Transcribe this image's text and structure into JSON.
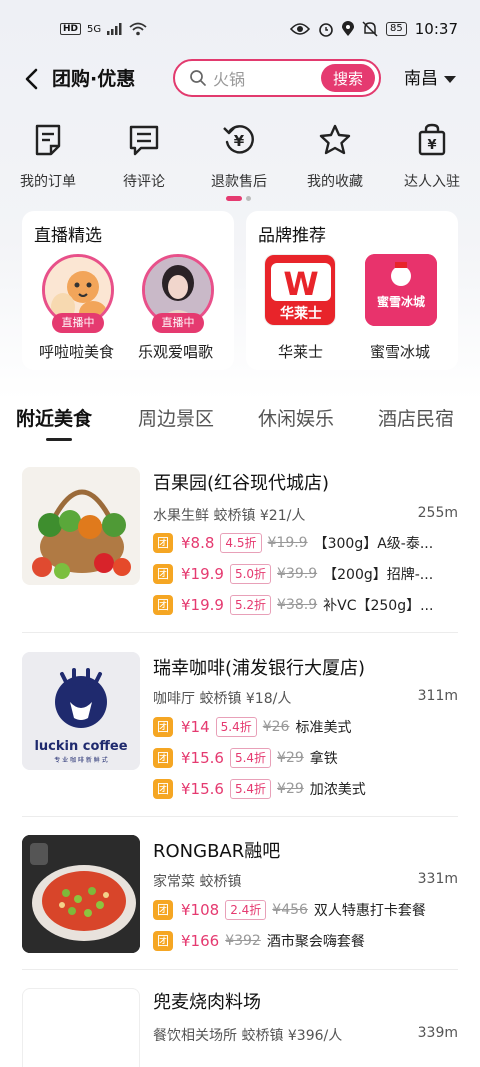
{
  "status": {
    "hd": "HD",
    "network": "5G",
    "battery": "85",
    "time": "10:37"
  },
  "nav": {
    "title": "团购·优惠",
    "search_value": "火锅",
    "search_button": "搜索",
    "city": "南昌"
  },
  "quick_entries": [
    {
      "label": "我的订单",
      "icon": "order-icon"
    },
    {
      "label": "待评论",
      "icon": "comment-icon"
    },
    {
      "label": "退款售后",
      "icon": "refund-icon"
    },
    {
      "label": "我的收藏",
      "icon": "star-icon"
    },
    {
      "label": "达人入驻",
      "icon": "bag-icon"
    }
  ],
  "live": {
    "title": "直播精选",
    "items": [
      {
        "name": "呼啦啦美食",
        "badge": "直播中"
      },
      {
        "name": "乐观爱唱歌",
        "badge": "直播中"
      }
    ]
  },
  "brands": {
    "title": "品牌推荐",
    "items": [
      {
        "name": "华莱士",
        "logo_text": "华莱士",
        "logo_mark": "W"
      },
      {
        "name": "蜜雪冰城",
        "logo_text": "蜜雪冰城"
      }
    ]
  },
  "tabs": [
    "附近美食",
    "周边景区",
    "休闲娱乐",
    "酒店民宿"
  ],
  "shops": [
    {
      "name": "百果园(红谷现代城店)",
      "meta": "水果生鲜 蛟桥镇 ¥21/人",
      "distance": "255m",
      "deals": [
        {
          "price": "¥8.8",
          "discount": "4.5折",
          "original": "¥19.9",
          "name": "【300g】A级-泰..."
        },
        {
          "price": "¥19.9",
          "discount": "5.0折",
          "original": "¥39.9",
          "name": "【200g】招牌-..."
        },
        {
          "price": "¥19.9",
          "discount": "5.2折",
          "original": "¥38.9",
          "name": "补VC【250g】..."
        }
      ]
    },
    {
      "name": "瑞幸咖啡(浦发银行大厦店)",
      "meta": "咖啡厅 蛟桥镇 ¥18/人",
      "distance": "311m",
      "logo_text": "luckin coffee",
      "logo_sub": "专 业 咖 啡 新 鲜 式",
      "deals": [
        {
          "price": "¥14",
          "discount": "5.4折",
          "original": "¥26",
          "name": "标准美式"
        },
        {
          "price": "¥15.6",
          "discount": "5.4折",
          "original": "¥29",
          "name": "拿铁"
        },
        {
          "price": "¥15.6",
          "discount": "5.4折",
          "original": "¥29",
          "name": "加浓美式"
        }
      ]
    },
    {
      "name": "RONGBAR融吧",
      "meta": "家常菜 蛟桥镇",
      "distance": "331m",
      "deals": [
        {
          "price": "¥108",
          "discount": "2.4折",
          "original": "¥456",
          "name": "双人特惠打卡套餐"
        },
        {
          "price": "¥166",
          "discount": "",
          "original": "¥392",
          "name": "酒市聚会嗨套餐"
        }
      ]
    },
    {
      "name": "兜麦烧肉料场",
      "meta": "餐饮相关场所 蛟桥镇 ¥396/人",
      "distance": "339m",
      "deals": []
    }
  ],
  "deal_badge": "团",
  "colors": {
    "accent": "#e53a70",
    "badge": "#f5a623"
  }
}
